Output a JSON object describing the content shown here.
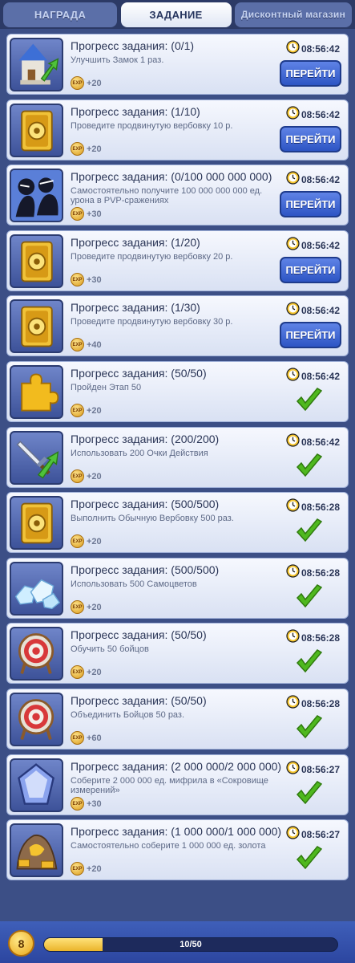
{
  "tabs": [
    {
      "label": "НАГРАДА",
      "active": false
    },
    {
      "label": "ЗАДАНИЕ",
      "active": true
    },
    {
      "label": "Дисконтный магазин",
      "active": false
    }
  ],
  "tasks": [
    {
      "icon": "castle-upgrade-icon",
      "title": "Прогресс задания: (0/1)",
      "desc": "Улучшить Замок 1 раз.",
      "exp": "+20",
      "timer": "08:56:42",
      "status": "go",
      "go_label": "ПЕРЕЙТИ"
    },
    {
      "icon": "recruit-card-icon",
      "title": "Прогресс задания: (1/10)",
      "desc": "Проведите продвинутую вербовку 10 р.",
      "exp": "+20",
      "timer": "08:56:42",
      "status": "go",
      "go_label": "ПЕРЕЙТИ"
    },
    {
      "icon": "pvp-fighters-icon",
      "title": "Прогресс задания: (0/100 000 000 000)",
      "desc": "Самостоятельно получите 100 000 000 000 ед. урона в PVP-сражениях",
      "exp": "+30",
      "timer": "08:56:42",
      "status": "go",
      "go_label": "ПЕРЕЙТИ"
    },
    {
      "icon": "recruit-card-icon",
      "title": "Прогресс задания: (1/20)",
      "desc": "Проведите продвинутую вербовку 20 р.",
      "exp": "+30",
      "timer": "08:56:42",
      "status": "go",
      "go_label": "ПЕРЕЙТИ"
    },
    {
      "icon": "recruit-card-icon",
      "title": "Прогресс задания: (1/30)",
      "desc": "Проведите продвинутую вербовку 30 р.",
      "exp": "+40",
      "timer": "08:56:42",
      "status": "go",
      "go_label": "ПЕРЕЙТИ"
    },
    {
      "icon": "puzzle-piece-icon",
      "title": "Прогресс задания: (50/50)",
      "desc": "Пройден Этап 50",
      "exp": "+20",
      "timer": "08:56:42",
      "status": "done"
    },
    {
      "icon": "sword-upgrade-icon",
      "title": "Прогресс задания: (200/200)",
      "desc": "Использовать 200 Очки Действия",
      "exp": "+20",
      "timer": "08:56:42",
      "status": "done"
    },
    {
      "icon": "recruit-card-icon",
      "title": "Прогресс задания: (500/500)",
      "desc": "Выполнить Обычную Вербовку 500 раз.",
      "exp": "+20",
      "timer": "08:56:28",
      "status": "done"
    },
    {
      "icon": "gems-pile-icon",
      "title": "Прогресс задания: (500/500)",
      "desc": "Использовать 500 Самоцветов",
      "exp": "+20",
      "timer": "08:56:28",
      "status": "done"
    },
    {
      "icon": "target-icon",
      "title": "Прогресс задания: (50/50)",
      "desc": "Обучить 50 бойцов",
      "exp": "+20",
      "timer": "08:56:28",
      "status": "done"
    },
    {
      "icon": "target-icon",
      "title": "Прогресс задания: (50/50)",
      "desc": "Объединить Бойцов 50 раз.",
      "exp": "+60",
      "timer": "08:56:28",
      "status": "done"
    },
    {
      "icon": "mithril-crystal-icon",
      "title": "Прогресс задания: (2 000 000/2 000 000)",
      "desc": "Соберите 2 000 000 ед. мифрила в «Сокровище измерений»",
      "exp": "+30",
      "timer": "08:56:27",
      "status": "done"
    },
    {
      "icon": "gold-ore-icon",
      "title": "Прогресс задания: (1 000 000/1 000 000)",
      "desc": "Самостоятельно соберите 1 000 000 ед. золота",
      "exp": "+20",
      "timer": "08:56:27",
      "status": "done"
    }
  ],
  "exp_badge": "EXP",
  "footer": {
    "level": "8",
    "progress_text": "10/50",
    "progress_fraction": 0.2
  },
  "colors": {
    "background": "#3c4f86",
    "go_button": "#2d55c4",
    "check": "#4fb81f",
    "exp_coin": "#e7a92a"
  }
}
